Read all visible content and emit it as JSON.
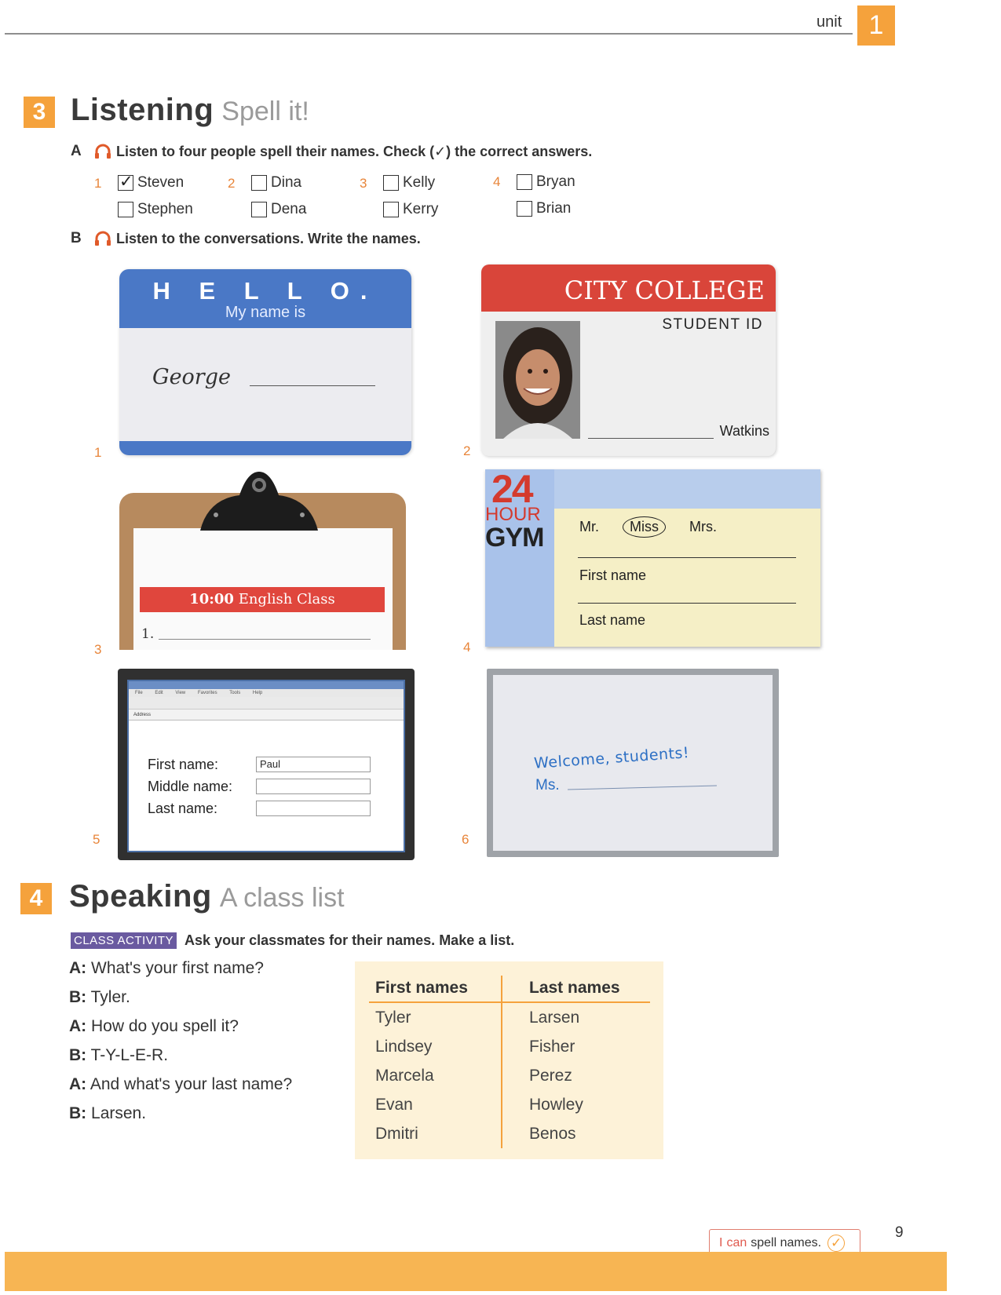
{
  "header": {
    "unit_label": "unit",
    "unit_number": "1"
  },
  "listening": {
    "number": "3",
    "title": "Listening",
    "subtitle": "Spell it!",
    "task_a": {
      "letter": "A",
      "text": "Listen to four people spell their names. Check (✓) the correct answers."
    },
    "questions": [
      {
        "num": "1",
        "options": [
          {
            "label": "Steven",
            "checked": true
          },
          {
            "label": "Stephen",
            "checked": false
          }
        ]
      },
      {
        "num": "2",
        "options": [
          {
            "label": "Dina",
            "checked": false
          },
          {
            "label": "Dena",
            "checked": false
          }
        ]
      },
      {
        "num": "3",
        "options": [
          {
            "label": "Kelly",
            "checked": false
          },
          {
            "label": "Kerry",
            "checked": false
          }
        ]
      },
      {
        "num": "4",
        "options": [
          {
            "label": "Bryan",
            "checked": false
          },
          {
            "label": "Brian",
            "checked": false
          }
        ]
      }
    ],
    "task_b": {
      "letter": "B",
      "text": "Listen to the conversations. Write the names."
    },
    "items": {
      "1": {
        "num": "1",
        "hello": "H E L L O.",
        "my_name_is": "My name is",
        "name": "George"
      },
      "2": {
        "num": "2",
        "college": "CITY COLLEGE",
        "student_id": "STUDENT ID",
        "last": "Watkins"
      },
      "3": {
        "num": "3",
        "time": "10:00",
        "class": "English Class",
        "line_num": "1."
      },
      "4": {
        "num": "4",
        "logo_24": "24",
        "logo_hour": "HOUR",
        "logo_gym": "GYM",
        "mr": "Mr.",
        "miss": "Miss",
        "mrs": "Mrs.",
        "first_name": "First name",
        "last_name": "Last name"
      },
      "5": {
        "num": "5",
        "menu": [
          "File",
          "Edit",
          "View",
          "Favorites",
          "Tools",
          "Help"
        ],
        "address": "Address",
        "first_label": "First name:",
        "first_value": "Paul",
        "middle_label": "Middle name:",
        "last_label": "Last name:"
      },
      "6": {
        "num": "6",
        "welcome": "Welcome, students!",
        "ms": "Ms."
      }
    }
  },
  "speaking": {
    "number": "4",
    "title": "Speaking",
    "subtitle": "A class list",
    "badge": "CLASS ACTIVITY",
    "instruction": "Ask your classmates for their names. Make a list.",
    "dialog": [
      {
        "speaker": "A:",
        "line": "What's your first name?"
      },
      {
        "speaker": "B:",
        "line": "Tyler."
      },
      {
        "speaker": "A:",
        "line": "How do you spell it?"
      },
      {
        "speaker": "B:",
        "line": "T-Y-L-E-R."
      },
      {
        "speaker": "A:",
        "line": "And what's your last name?"
      },
      {
        "speaker": "B:",
        "line": "Larsen."
      }
    ],
    "table": {
      "headers": [
        "First names",
        "Last names"
      ],
      "rows": [
        [
          "Tyler",
          "Larsen"
        ],
        [
          "Lindsey",
          "Fisher"
        ],
        [
          "Marcela",
          "Perez"
        ],
        [
          "Evan",
          "Howley"
        ],
        [
          "Dmitri",
          "Benos"
        ]
      ]
    }
  },
  "footer": {
    "ican_i": "I",
    "ican_can": "can",
    "ican_rest": "spell names.",
    "page": "9"
  },
  "colors": {
    "accent": "#f5a23c",
    "number_orange": "#e8853a",
    "badge_purple": "#6a5aa0",
    "board_blue": "#2c6fc4"
  }
}
